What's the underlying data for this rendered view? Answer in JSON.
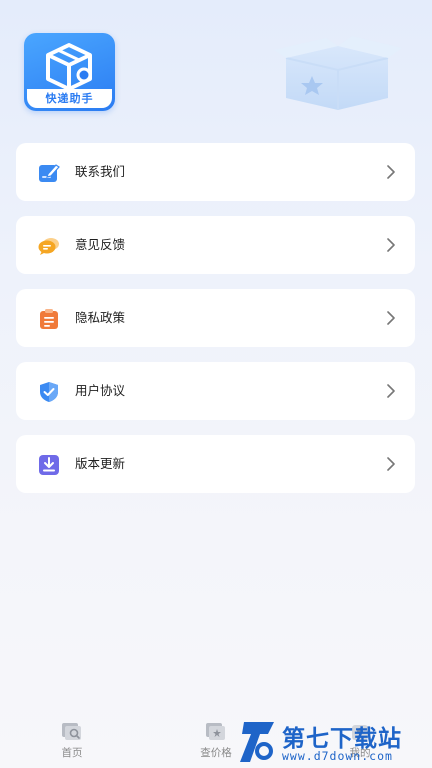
{
  "app": {
    "logo_label": "快递助手"
  },
  "menu": {
    "items": [
      {
        "label": "联系我们",
        "icon": "edit-note-icon",
        "color": "#3b8af2"
      },
      {
        "label": "意见反馈",
        "icon": "chat-bubbles-icon",
        "color": "#f5a623"
      },
      {
        "label": "隐私政策",
        "icon": "clipboard-icon",
        "color": "#f07a3a"
      },
      {
        "label": "用户协议",
        "icon": "shield-check-icon",
        "color": "#3b8af2"
      },
      {
        "label": "版本更新",
        "icon": "download-box-icon",
        "color": "#6f6ae8"
      }
    ]
  },
  "nav": {
    "items": [
      {
        "label": "首页",
        "icon": "home-search-icon"
      },
      {
        "label": "查价格",
        "icon": "price-tag-icon"
      },
      {
        "label": "我的",
        "icon": "profile-icon"
      }
    ]
  },
  "watermark": {
    "title": "第七下载站",
    "url": "www.d7down.com"
  },
  "colors": {
    "accent": "#2b7cf2",
    "background": "#eef2fb",
    "card": "#ffffff"
  }
}
